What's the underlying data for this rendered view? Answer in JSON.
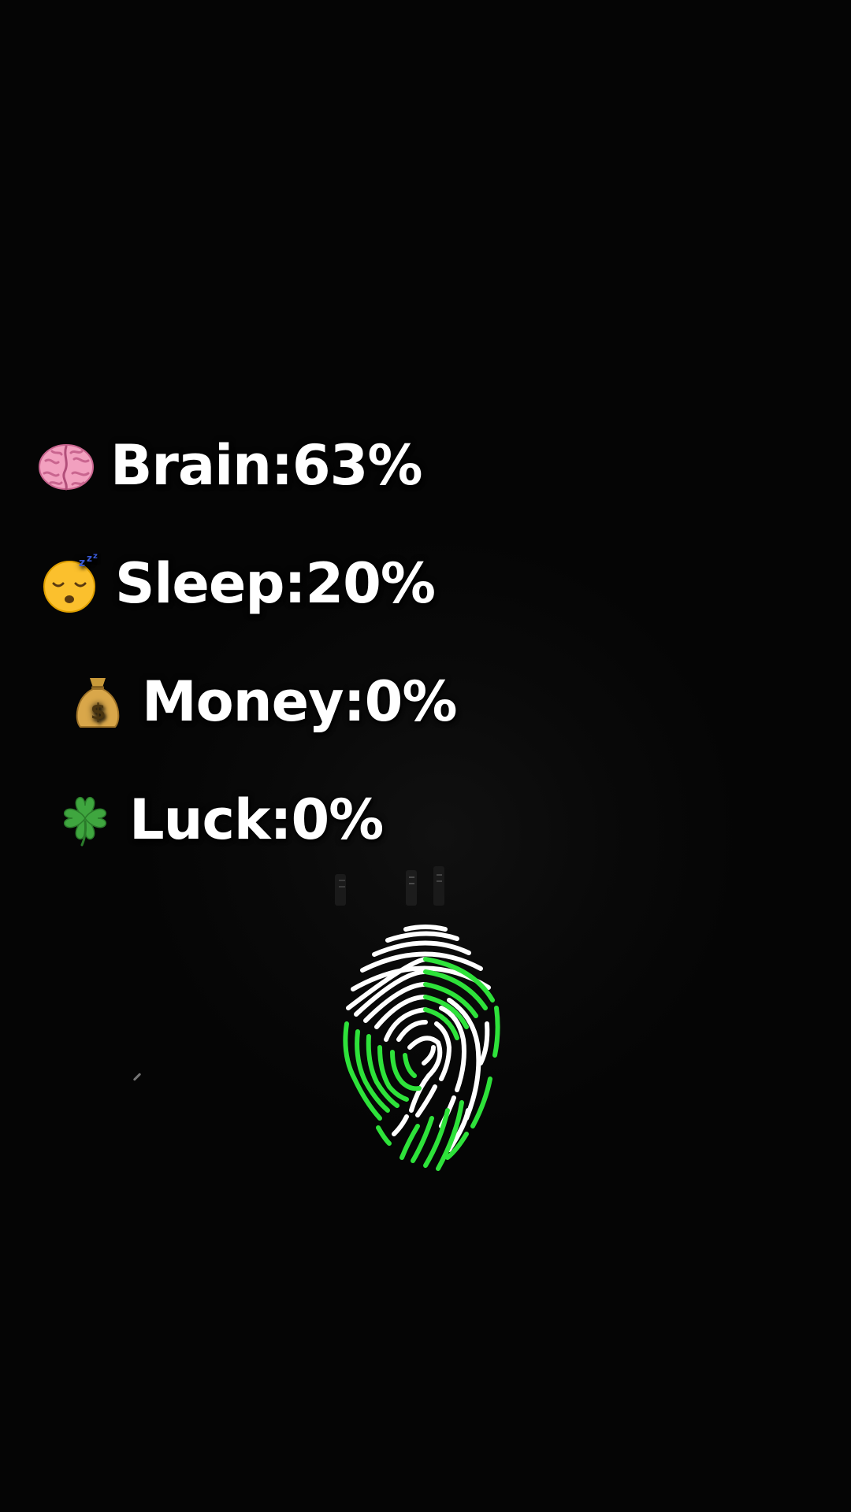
{
  "stats": [
    {
      "icon": "brain-icon",
      "label": "Brain:63%"
    },
    {
      "icon": "sleeping-face-icon",
      "label": "Sleep:20%"
    },
    {
      "icon": "money-bag-icon",
      "label": "Money:0%"
    },
    {
      "icon": "four-leaf-clover-icon",
      "label": "Luck:0%"
    }
  ],
  "fingerprint": {
    "icon": "fingerprint-icon",
    "accent_color": "#2ee23a",
    "base_color": "#ffffff"
  },
  "colors": {
    "background": "#050505",
    "text": "#ffffff"
  }
}
